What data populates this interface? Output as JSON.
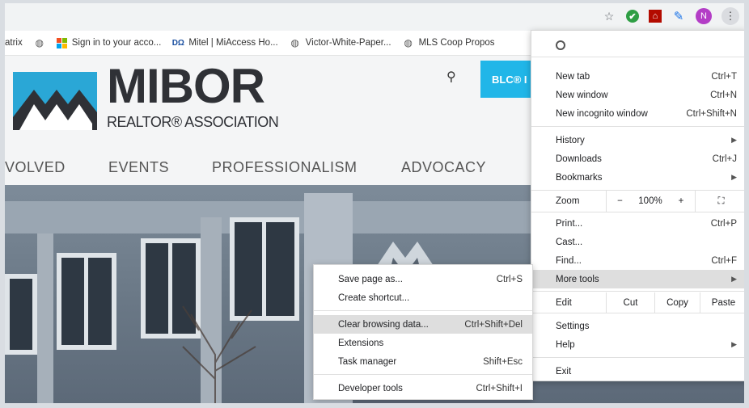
{
  "toolbar": {
    "icons": [
      "star-icon",
      "green-check-extension-icon",
      "adobe-pdf-icon",
      "pen-extension-icon"
    ],
    "avatar_letter": "N",
    "menu_icon": "⋮"
  },
  "bookmarks": [
    {
      "label": "atrix",
      "icon": "none"
    },
    {
      "label": "",
      "icon": "globe"
    },
    {
      "label": "Sign in to your acco...",
      "icon": "microsoft"
    },
    {
      "label": "Mitel | MiAccess Ho...",
      "icon": "mitel"
    },
    {
      "label": "Victor-White-Paper...",
      "icon": "globe"
    },
    {
      "label": "MLS Coop Propos",
      "icon": "globe"
    }
  ],
  "site": {
    "logo_big": "MIBOR",
    "logo_sub": "REALTOR® ASSOCIATION",
    "blc_label": "BLC® I",
    "nav": [
      "VOLVED",
      "EVENTS",
      "PROFESSIONALISM",
      "ADVOCACY"
    ]
  },
  "chrome_menu": {
    "new_tab": {
      "label": "New tab",
      "shortcut": "Ctrl+T"
    },
    "new_window": {
      "label": "New window",
      "shortcut": "Ctrl+N"
    },
    "new_incognito": {
      "label": "New incognito window",
      "shortcut": "Ctrl+Shift+N"
    },
    "history": {
      "label": "History"
    },
    "downloads": {
      "label": "Downloads",
      "shortcut": "Ctrl+J"
    },
    "bookmarks": {
      "label": "Bookmarks"
    },
    "zoom": {
      "label": "Zoom",
      "minus": "−",
      "value": "100%",
      "plus": "+",
      "fullscreen": "⛶"
    },
    "print": {
      "label": "Print...",
      "shortcut": "Ctrl+P"
    },
    "cast": {
      "label": "Cast..."
    },
    "find": {
      "label": "Find...",
      "shortcut": "Ctrl+F"
    },
    "more_tools": {
      "label": "More tools"
    },
    "edit": {
      "label": "Edit",
      "cut": "Cut",
      "copy": "Copy",
      "paste": "Paste"
    },
    "settings": {
      "label": "Settings"
    },
    "help": {
      "label": "Help"
    },
    "exit": {
      "label": "Exit"
    }
  },
  "more_tools_menu": {
    "save_page": {
      "label": "Save page as...",
      "shortcut": "Ctrl+S"
    },
    "create_shortcut": {
      "label": "Create shortcut..."
    },
    "clear_data": {
      "label": "Clear browsing data...",
      "shortcut": "Ctrl+Shift+Del"
    },
    "extensions": {
      "label": "Extensions"
    },
    "task_manager": {
      "label": "Task manager",
      "shortcut": "Shift+Esc"
    },
    "dev_tools": {
      "label": "Developer tools",
      "shortcut": "Ctrl+Shift+I"
    }
  },
  "colors": {
    "accent": "#21b6e8",
    "highlight": "#dedede",
    "avatar": "#b33dc6"
  }
}
